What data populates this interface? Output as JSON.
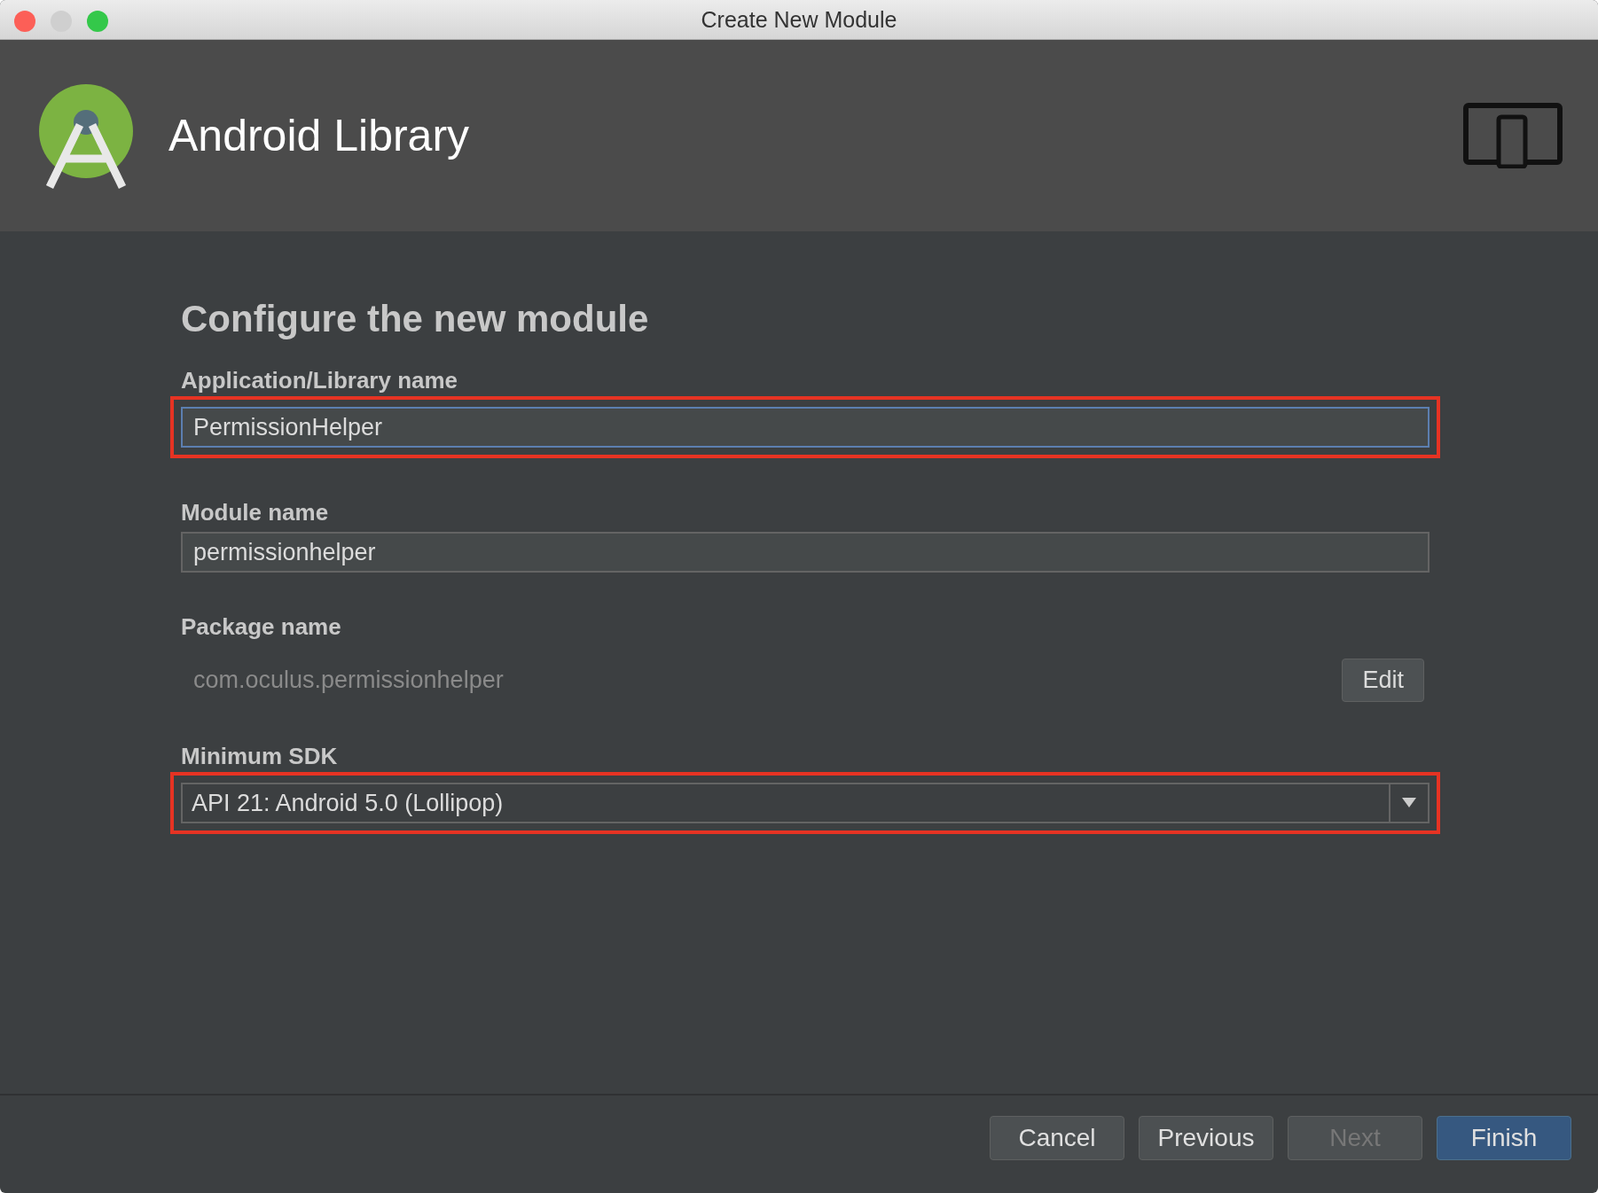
{
  "window": {
    "title": "Create New Module"
  },
  "header": {
    "title": "Android Library"
  },
  "heading": "Configure the new module",
  "fields": [
    {
      "kind": "text",
      "label": "Application/Library name",
      "value": "PermissionHelper",
      "focused": true,
      "highlighted": true
    },
    {
      "kind": "text",
      "label": "Module name",
      "value": "permissionhelper",
      "focused": false,
      "highlighted": false
    },
    {
      "kind": "readonly",
      "label": "Package name",
      "value": "com.oculus.permissionhelper",
      "button": "Edit",
      "highlighted": false
    },
    {
      "kind": "dropdown",
      "label": "Minimum SDK",
      "value": "API 21: Android 5.0 (Lollipop)",
      "highlighted": true
    }
  ],
  "buttons": [
    {
      "label": "Cancel",
      "disabled": false,
      "default": false
    },
    {
      "label": "Previous",
      "disabled": false,
      "default": false
    },
    {
      "label": "Next",
      "disabled": true,
      "default": false
    },
    {
      "label": "Finish",
      "disabled": false,
      "default": true
    }
  ]
}
